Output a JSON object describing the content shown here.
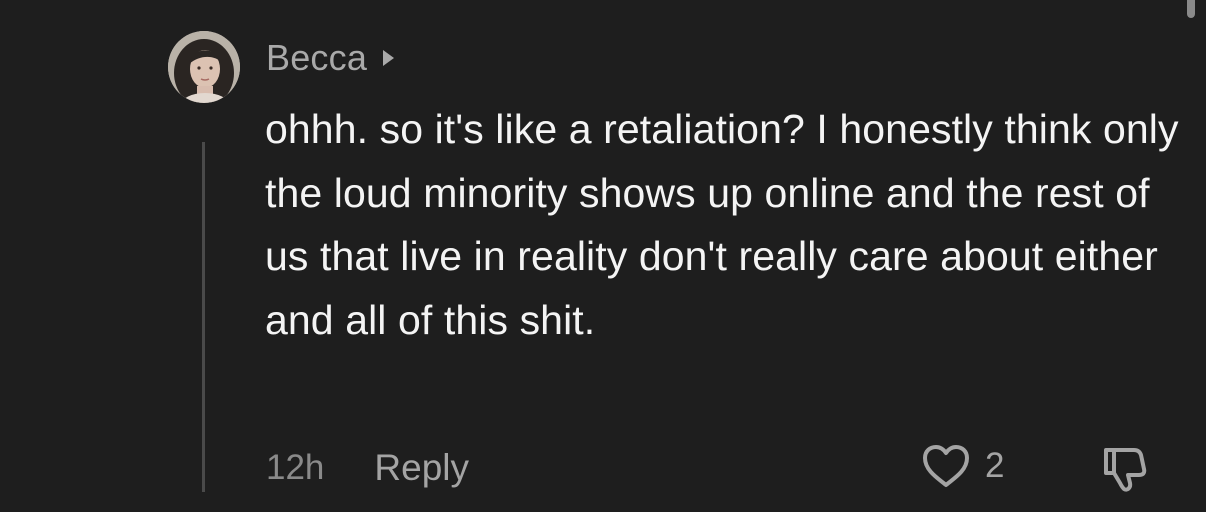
{
  "comment": {
    "author": "Becca",
    "text": "ohhh. so it's like a retaliation? I honestly think only the loud minority shows up online and the rest of us that live in reality don't really care about either and all of this shit.",
    "timestamp": "12h",
    "reply_label": "Reply",
    "like_count": "2"
  },
  "icons": {
    "author_link": "chevron-right-icon",
    "like": "heart-outline-icon",
    "dislike": "thumbs-down-outline-icon"
  },
  "colors": {
    "background": "#1e1e1e",
    "primary_text": "#f4f4f4",
    "secondary_text": "#a9a9a9",
    "muted_text": "#8a8a8a",
    "thread_line": "#4a4a4a"
  }
}
